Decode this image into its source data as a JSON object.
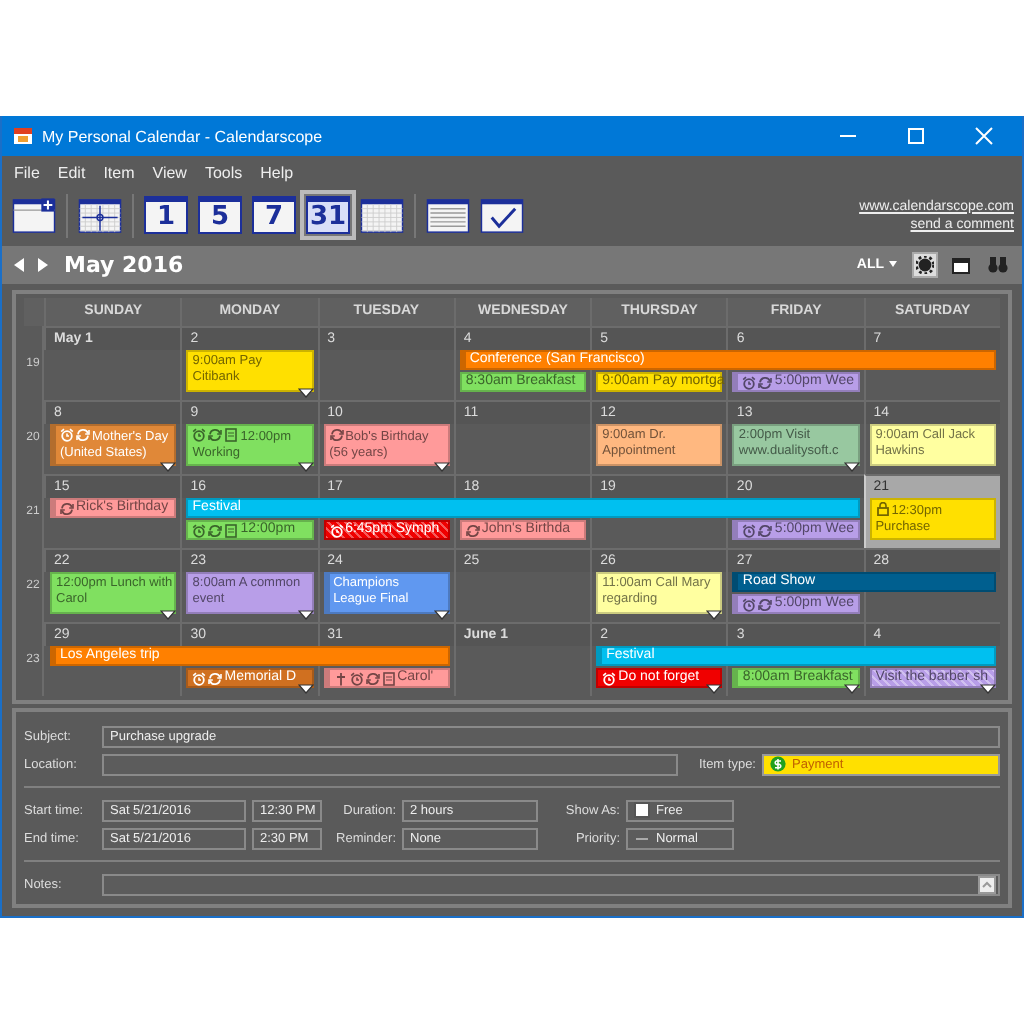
{
  "window": {
    "title": "My Personal Calendar - Calendarscope"
  },
  "menu": [
    "File",
    "Edit",
    "Item",
    "View",
    "Tools",
    "Help"
  ],
  "toolbar": [
    {
      "kind": "new",
      "selected": false
    },
    {
      "kind": "day",
      "selected": false
    },
    {
      "kind": "number",
      "label": "1",
      "selected": false
    },
    {
      "kind": "number",
      "label": "5",
      "selected": false
    },
    {
      "kind": "number",
      "label": "7",
      "selected": false
    },
    {
      "kind": "number",
      "label": "31",
      "selected": true
    },
    {
      "kind": "month",
      "selected": false
    },
    {
      "kind": "list",
      "selected": false
    },
    {
      "kind": "tasks",
      "selected": false
    }
  ],
  "links": [
    "www.calendarscope.com",
    "send a comment"
  ],
  "nav": {
    "title": "May 2016",
    "filter": "ALL",
    "tools": [
      {
        "kind": "gear",
        "selected": true
      },
      {
        "kind": "window",
        "selected": false
      },
      {
        "kind": "binoculars",
        "selected": false
      }
    ]
  },
  "calendar": {
    "days": [
      "SUNDAY",
      "MONDAY",
      "TUESDAY",
      "WEDNESDAY",
      "THURSDAY",
      "FRIDAY",
      "SATURDAY"
    ],
    "weeks": [
      {
        "number": "19",
        "dates": [
          {
            "label": "May 1",
            "bold": true,
            "selected": false
          },
          {
            "label": "2",
            "bold": false,
            "selected": false,
            "events": [
              {
                "kind": "box",
                "text": "9:00am Pay Citibank",
                "color": "#ffe000",
                "more": true
              }
            ]
          },
          {
            "label": "3",
            "bold": false,
            "selected": false
          },
          {
            "label": "4",
            "bold": false,
            "selected": false,
            "events": [
              {
                "kind": "bar",
                "text": "Conference (San Francisco)",
                "color": "#ff8000",
                "tagged": true
              },
              {
                "kind": "bar",
                "text": "8:30am Breakfast",
                "color": "#80e060"
              }
            ]
          },
          {
            "label": "5",
            "bold": false,
            "selected": false,
            "events": [
              {
                "kind": "continuation"
              },
              {
                "kind": "bar",
                "text": "9:00am Pay mortga",
                "color": "#ffe000"
              }
            ]
          },
          {
            "label": "6",
            "bold": false,
            "selected": false,
            "events": [
              {
                "kind": "continuation"
              },
              {
                "kind": "bar",
                "text": "5:00pm Wee",
                "color": "#b89ee8",
                "stripe": true,
                "alarm": true,
                "recurring": true
              }
            ]
          },
          {
            "label": "7",
            "bold": false,
            "selected": false,
            "events": [
              {
                "kind": "continuation"
              }
            ]
          }
        ]
      },
      {
        "number": "20",
        "dates": [
          {
            "label": "8",
            "bold": false,
            "selected": false,
            "events": [
              {
                "kind": "box",
                "text": "Mother's Day (United States)",
                "color": "#e08838",
                "stripe": true,
                "alarm": true,
                "recurring": true,
                "more": true
              }
            ]
          },
          {
            "label": "9",
            "bold": false,
            "selected": false,
            "events": [
              {
                "kind": "box",
                "text": "12:00pm Working",
                "color": "#80e060",
                "alarm": true,
                "note": true,
                "recurring": true,
                "more": true
              }
            ]
          },
          {
            "label": "10",
            "bold": false,
            "selected": false,
            "events": [
              {
                "kind": "box",
                "text": "Bob's Birthday (56 years)",
                "color": "#ff9a9a",
                "recurring": true,
                "more": true
              }
            ]
          },
          {
            "label": "11",
            "bold": false,
            "selected": false
          },
          {
            "label": "12",
            "bold": false,
            "selected": false,
            "events": [
              {
                "kind": "box",
                "text": "9:00am Dr. Appointment",
                "color": "#ffb880"
              }
            ]
          },
          {
            "label": "13",
            "bold": false,
            "selected": false,
            "events": [
              {
                "kind": "box",
                "text": "2:00pm Visit www.dualitysoft.c",
                "color": "#98c8a0",
                "more": true
              }
            ]
          },
          {
            "label": "14",
            "bold": false,
            "selected": false,
            "events": [
              {
                "kind": "box",
                "text": "9:00am Call Jack Hawkins",
                "color": "#ffffa0"
              }
            ]
          }
        ]
      },
      {
        "number": "21",
        "dates": [
          {
            "label": "15",
            "bold": false,
            "selected": false,
            "events": [
              {
                "kind": "bar",
                "text": "Rick's Birthday",
                "color": "#ff9a9a",
                "stripe": true,
                "recurring": true
              }
            ]
          },
          {
            "label": "16",
            "bold": false,
            "selected": false,
            "events": [
              {
                "kind": "bar",
                "text": "Festival",
                "color": "#00c0f0"
              },
              {
                "kind": "bar",
                "text": "12:00pm",
                "color": "#80e060",
                "alarm": true,
                "recurring": true,
                "note": true
              }
            ]
          },
          {
            "label": "17",
            "bold": false,
            "selected": false,
            "events": [
              {
                "kind": "continuation"
              },
              {
                "kind": "bar",
                "text": "6:45pm Symph",
                "color": "#f00000",
                "hatched": true,
                "alarm": true
              }
            ]
          },
          {
            "label": "18",
            "bold": false,
            "selected": false,
            "events": [
              {
                "kind": "continuation"
              },
              {
                "kind": "bar",
                "text": "John's Birthda",
                "color": "#ff9a9a",
                "recurring": true
              }
            ]
          },
          {
            "label": "19",
            "bold": false,
            "selected": false,
            "events": [
              {
                "kind": "continuation"
              }
            ]
          },
          {
            "label": "20",
            "bold": false,
            "selected": false,
            "events": [
              {
                "kind": "continuation"
              },
              {
                "kind": "bar",
                "text": "5:00pm Wee",
                "color": "#b89ee8",
                "stripe": true,
                "alarm": true,
                "recurring": true
              }
            ]
          },
          {
            "label": "21",
            "bold": false,
            "selected": true,
            "events": [
              {
                "kind": "box",
                "text": "12:30pm Purchase",
                "color": "#ffe000",
                "lock": true
              }
            ]
          }
        ]
      },
      {
        "number": "22",
        "dates": [
          {
            "label": "22",
            "bold": false,
            "selected": false,
            "events": [
              {
                "kind": "box",
                "text": "12:00pm Lunch with Carol",
                "color": "#80e060",
                "more": true
              }
            ]
          },
          {
            "label": "23",
            "bold": false,
            "selected": false,
            "events": [
              {
                "kind": "box",
                "text": "8:00am A common event",
                "color": "#b89ee8",
                "more": true
              }
            ]
          },
          {
            "label": "24",
            "bold": false,
            "selected": false,
            "events": [
              {
                "kind": "box",
                "text": "Champions League Final",
                "color": "#6098f0",
                "stripe": true,
                "more": true
              }
            ]
          },
          {
            "label": "25",
            "bold": false,
            "selected": false
          },
          {
            "label": "26",
            "bold": false,
            "selected": false,
            "events": [
              {
                "kind": "box",
                "text": "11:00am Call Mary regarding",
                "color": "#ffffa0",
                "more": true
              }
            ]
          },
          {
            "label": "27",
            "bold": false,
            "selected": false,
            "events": [
              {
                "kind": "bar",
                "text": "Road Show",
                "color": "#005f8f",
                "stripe": true
              },
              {
                "kind": "bar",
                "text": "5:00pm Wee",
                "color": "#b89ee8",
                "stripe": true,
                "alarm": true,
                "recurring": true
              }
            ]
          },
          {
            "label": "28",
            "bold": false,
            "selected": false,
            "events": [
              {
                "kind": "continuation"
              }
            ]
          }
        ]
      },
      {
        "number": "23",
        "dates": [
          {
            "label": "29",
            "bold": false,
            "selected": false,
            "events": [
              {
                "kind": "bar",
                "text": "Los Angeles trip",
                "color": "#ff8000",
                "stripe": true
              }
            ]
          },
          {
            "label": "30",
            "bold": false,
            "selected": false,
            "events": [
              {
                "kind": "continuation"
              },
              {
                "kind": "bar",
                "text": "Memorial D",
                "color": "#d07020",
                "alarm": true,
                "recurring": true,
                "more": true
              }
            ]
          },
          {
            "label": "31",
            "bold": false,
            "selected": false,
            "events": [
              {
                "kind": "continuation"
              },
              {
                "kind": "bar",
                "text": "Carol'",
                "color": "#ff9a9a",
                "stripe": true,
                "cross": true,
                "alarm": true,
                "recurring": true,
                "note": true
              }
            ]
          },
          {
            "label": "June 1",
            "bold": true,
            "selected": false
          },
          {
            "label": "2",
            "bold": false,
            "selected": false,
            "events": [
              {
                "kind": "bar",
                "text": "Festival",
                "color": "#00c0f0",
                "stripe": true
              },
              {
                "kind": "bar",
                "text": "Do not forget",
                "color": "#f00000",
                "alarm": true,
                "more": true
              }
            ]
          },
          {
            "label": "3",
            "bold": false,
            "selected": false,
            "events": [
              {
                "kind": "continuation"
              },
              {
                "kind": "bar",
                "text": "8:00am Breakfast",
                "color": "#80e060",
                "tagged": true,
                "more": true
              }
            ]
          },
          {
            "label": "4",
            "bold": false,
            "selected": false,
            "events": [
              {
                "kind": "continuation"
              },
              {
                "kind": "bar",
                "text": "Visit the barber sh",
                "color": "#b89ee8",
                "hatched": true,
                "more": true
              }
            ]
          }
        ]
      }
    ]
  },
  "details": {
    "subject": {
      "label": "Subject:",
      "value": "Purchase upgrade"
    },
    "location": {
      "label": "Location:"
    },
    "item_type": {
      "label": "Item type:",
      "value": "Payment"
    },
    "start": {
      "label": "Start time:",
      "date": "Sat 5/21/2016",
      "time": "12:30 PM"
    },
    "end": {
      "label": "End time:",
      "date": "Sat 5/21/2016",
      "time": "2:30 PM"
    },
    "duration": {
      "label": "Duration:",
      "value": "2 hours"
    },
    "reminder": {
      "label": "Reminder:",
      "value": "None"
    },
    "show_as": {
      "label": "Show As:",
      "value": "Free"
    },
    "priority": {
      "label": "Priority:",
      "value": "Normal"
    },
    "notes": {
      "label": "Notes:"
    }
  }
}
